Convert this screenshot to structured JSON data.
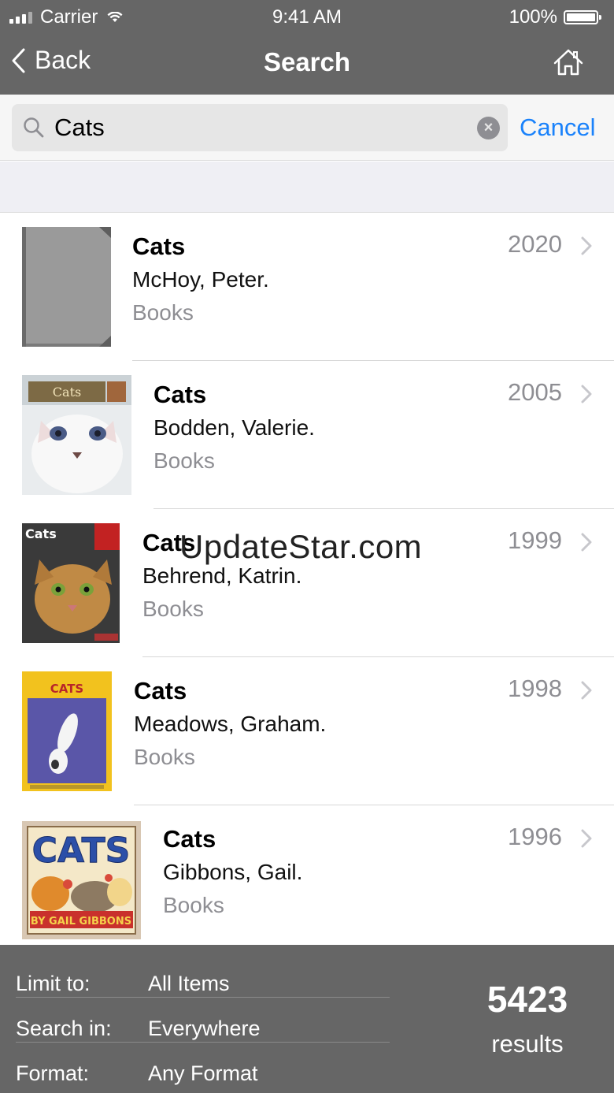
{
  "status_bar": {
    "carrier": "Carrier",
    "time": "9:41 AM",
    "battery": "100%"
  },
  "nav": {
    "back_label": "Back",
    "title": "Search",
    "home_icon": "home-icon"
  },
  "search": {
    "query": "Cats",
    "cancel_label": "Cancel"
  },
  "results": [
    {
      "title": "Cats",
      "author": "McHoy, Peter.",
      "format": "Books",
      "year": "2020",
      "cover": "plain-gray-book"
    },
    {
      "title": "Cats",
      "author": "Bodden, Valerie.",
      "format": "Books",
      "year": "2005",
      "cover": "white-kitten",
      "cover_text": "Cats"
    },
    {
      "title": "Cats",
      "author": "Behrend, Katrin.",
      "format": "Books",
      "year": "1999",
      "cover": "tabby-cat",
      "cover_text": "Cats"
    },
    {
      "title": "Cats",
      "author": "Meadows, Graham.",
      "format": "Books",
      "year": "1998",
      "cover": "animals-are-not-like-us",
      "cover_text": "CATS"
    },
    {
      "title": "Cats",
      "author": "Gibbons, Gail.",
      "format": "Books",
      "year": "1996",
      "cover": "illustrated-cats",
      "cover_text": "CATS",
      "cover_subtext": "BY GAIL GIBBONS"
    }
  ],
  "watermark": "UpdateStar.com",
  "footer": {
    "filters": [
      {
        "label": "Limit to:",
        "value": "All Items"
      },
      {
        "label": "Search in:",
        "value": "Everywhere"
      },
      {
        "label": "Format:",
        "value": "Any Format"
      }
    ],
    "result_count": "5423",
    "result_label": "results"
  },
  "colors": {
    "bar_bg": "#666666",
    "accent": "#1a82fb",
    "secondary_text": "#8e8e93"
  }
}
